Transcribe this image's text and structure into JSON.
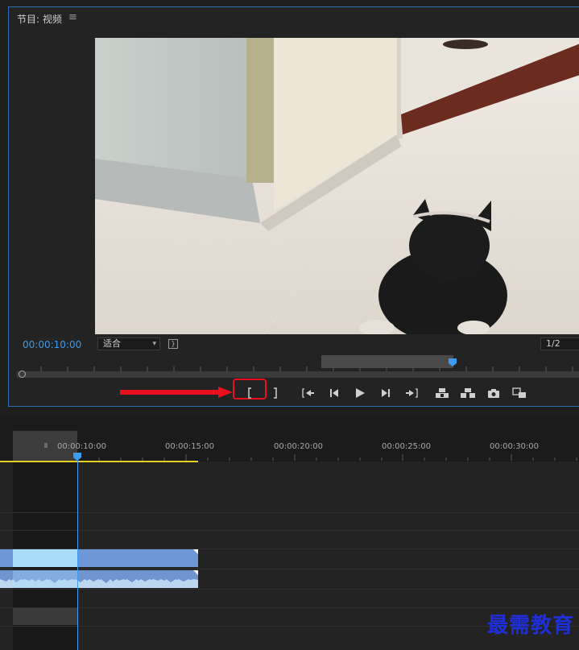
{
  "monitor": {
    "title": "节目: 视频",
    "menu_icon": "hamburger-icon",
    "timecode": "00:00:10:00",
    "zoom_label": "适合",
    "resolution_label": "1/2"
  },
  "transport": {
    "buttons": [
      "mark-in-icon",
      "mark-out-icon",
      "go-to-in-icon",
      "step-back-icon",
      "play-icon",
      "step-forward-icon",
      "go-to-out-icon",
      "lift-icon",
      "extract-icon",
      "export-frame-icon",
      "compare-view-icon"
    ],
    "highlight_color": "#e8101e"
  },
  "timeline": {
    "ruler_labels": [
      "00:00:10:00",
      "00:00:15:00",
      "00:00:20:00",
      "00:00:25:00",
      "00:00:30:00"
    ],
    "playhead_color": "#3d9bf0",
    "work_area_color": "#e5d022"
  },
  "watermark": "最需教育"
}
